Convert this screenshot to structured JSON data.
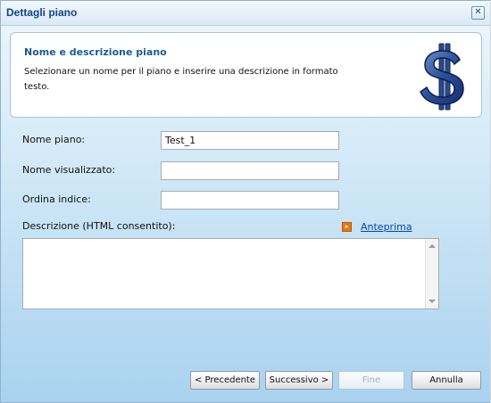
{
  "window": {
    "title": "Dettagli piano",
    "close_symbol": "✕"
  },
  "header": {
    "title": "Nome e descrizione piano",
    "description": "Selezionare un nome per il piano e inserire una descrizione in formato testo.",
    "icon": "dollar-sign-icon"
  },
  "form": {
    "plan_name": {
      "label": "Nome piano:",
      "value": "Test_1"
    },
    "display_name": {
      "label": "Nome visualizzato:",
      "value": ""
    },
    "sort_index": {
      "label": "Ordina indice:",
      "value": ""
    },
    "description": {
      "label": "Descrizione (HTML consentito):",
      "value": ""
    },
    "preview_link": "Anteprima"
  },
  "buttons": {
    "previous": "< Precedente",
    "next": "Successivo >",
    "finish": "Fine",
    "cancel": "Annulla"
  },
  "colors": {
    "title_text": "#15428b",
    "accent_orange": "#e87a12",
    "link": "#0645ad"
  }
}
